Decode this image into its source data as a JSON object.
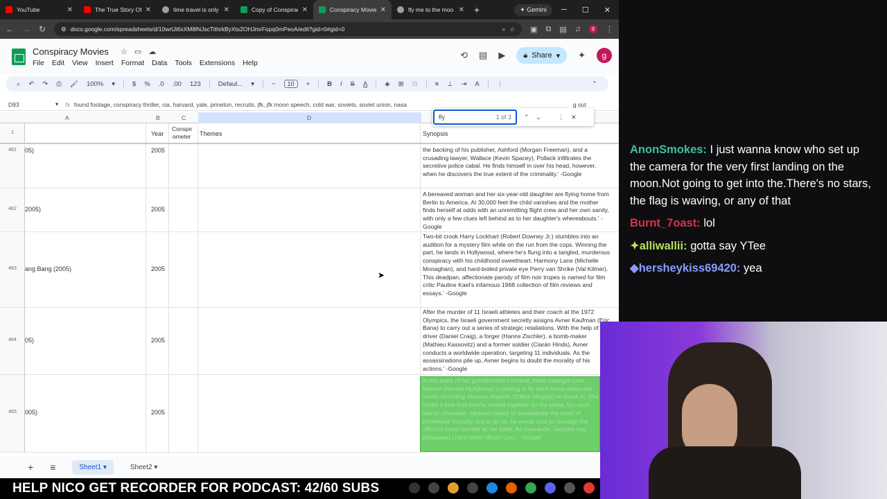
{
  "browser": {
    "tabs": [
      {
        "title": "YouTube",
        "color": "#ff0000"
      },
      {
        "title": "The True Story Of",
        "color": "#ff0000"
      },
      {
        "title": "time travel is only",
        "color": "#9aa0a6"
      },
      {
        "title": "Copy of Conspirac",
        "color": "#0f9d58"
      },
      {
        "title": "Conspiracy Movie",
        "color": "#0f9d58"
      },
      {
        "title": "fly me to the moo",
        "color": "#9aa0a6"
      }
    ],
    "gemini_label": "Gemini",
    "url": "docs.google.com/spreadsheets/d/10wrtJi6xXM8lNJscTithrkByXts2OHJmrFopq0mPeoA/edit?gid=0#gid=0",
    "profile_initial": "g"
  },
  "doc": {
    "title": "Conspiracy Movies",
    "menu": [
      "File",
      "Edit",
      "View",
      "Insert",
      "Format",
      "Data",
      "Tools",
      "Extensions",
      "Help"
    ],
    "share_label": "Share",
    "user_initial": "g"
  },
  "toolbar": {
    "zoom": "100%",
    "currency": "$",
    "percent": "%",
    "dec_down": ".0",
    "dec_up": ".00",
    "num_format": "123",
    "font": "Defaul...",
    "font_size": "10"
  },
  "formula": {
    "cell_ref": "D93",
    "fx": "fx",
    "content": "found footage, conspiracy thriller, cia, harvard, yale, prineton, recruits, jfk, jfk moon speech, cold war, soviets, soviet union, nasa",
    "overflow": "g out"
  },
  "find": {
    "query": "fly",
    "count": "1 of 3"
  },
  "columns": {
    "a": "A",
    "b": "B",
    "c": "C",
    "d": "D",
    "row1": "1"
  },
  "frozen_header": {
    "year": "Year",
    "conspir": "Conspir",
    "ometer": "ometer",
    "themes": "Themes",
    "synopsis": "Synopsis"
  },
  "rows": [
    {
      "num": "461",
      "title": "05)",
      "year": "2005",
      "synopsis": "the backing of his publisher, Ashford (Morgan Freeman), and a crusading lawyer, Wallace (Kevin Spacey), Pollack infiltrates the secretive police cabal. He finds himself in over his head, however, when he discovers the true extent of the criminality.' -Google"
    },
    {
      "num": "462",
      "title": "2005)",
      "year": "2005",
      "synopsis": "A bereaved woman and her six-year-old daughter are flying home from Berlin to America. At 30,000 feet the child vanishes and the mother finds herself at odds with an unremitting flight crew and her own sanity, with only a few clues left behind as to her daughter's whereabouts.' -Google"
    },
    {
      "num": "463",
      "title": "ang Bang (2005)",
      "year": "2005",
      "synopsis": "Two-bit crook Harry Lockhart (Robert Downey Jr.) stumbles into an audition for a mystery film while on the run from the cops. Winning the part, he lands in Hollywood, where he's flung into a tangled, murderous conspiracy with his childhood sweetheart, Harmony Lane (Michelle Monaghan), and hard-boiled private eye Perry van Shrike (Val Kilmer). This deadpan, affectionate parody of film noir tropes is named for film critic Pauline Kael's infamous 1968 collection of film reviews and essays.' -Google"
    },
    {
      "num": "464",
      "title": "05)",
      "year": "2005",
      "synopsis": "After the murder of 11 Israeli athletes and their coach at the 1972 Olympics, the Israeli government secretly assigns Avner Kaufman (Eric Bana) to carry out a series of strategic retaliations. With the help of a driver (Daniel Craig), a forger (Hanns Zischler), a bomb-maker (Mathieu Kassovitz) and a former soldier (Ciarán Hinds), Avner conducts a worldwide operation, targeting 11 individuals. As the assassinations pile up, Avner begins to doubt the morality of his actions.' -Google"
    },
    {
      "num": "465",
      "title": "005)",
      "year": "2005",
      "synopsis": "In the wake of her grandmother's funeral, hotel manager Lisa Reisert (Rachel McAdams) is waiting to fly back home when she meets charming Jackson Rippner (Cillian Murphy) at check-in. She thinks it luck that they're seated together on the plane, but soon learns otherwise. Jackson hopes to assassinate the head of Homeland Security, but to do so, he needs Lisa to reassign the official's room number at her hotel. As insurance, Jackson has kidnapped Lisa's father (Brian Cox).' -Google"
    }
  ],
  "sheets": {
    "add": "+",
    "list": "≡",
    "sheet1": "Sheet1",
    "sheet2": "Sheet2"
  },
  "banner": "HELP NICO GET RECORDER FOR PODCAST: 42/60 SUBS",
  "chat": [
    {
      "user": "AnonSmokes:",
      "color": "#3fbfa5",
      "text": " I just wanna know who set up the camera for the very first landing on the moon.Not going to get into the.There's no stars, the flag is waving, or any of that"
    },
    {
      "user": "Burnt_7oast:",
      "color": "#d6334b",
      "text": " lol"
    },
    {
      "user": "✦alliwallii:",
      "color": "#b7e05a",
      "text": " gotta say YTee"
    },
    {
      "user": "◆hersheykiss69420:",
      "color": "#8a9bff",
      "text": " yea"
    }
  ]
}
